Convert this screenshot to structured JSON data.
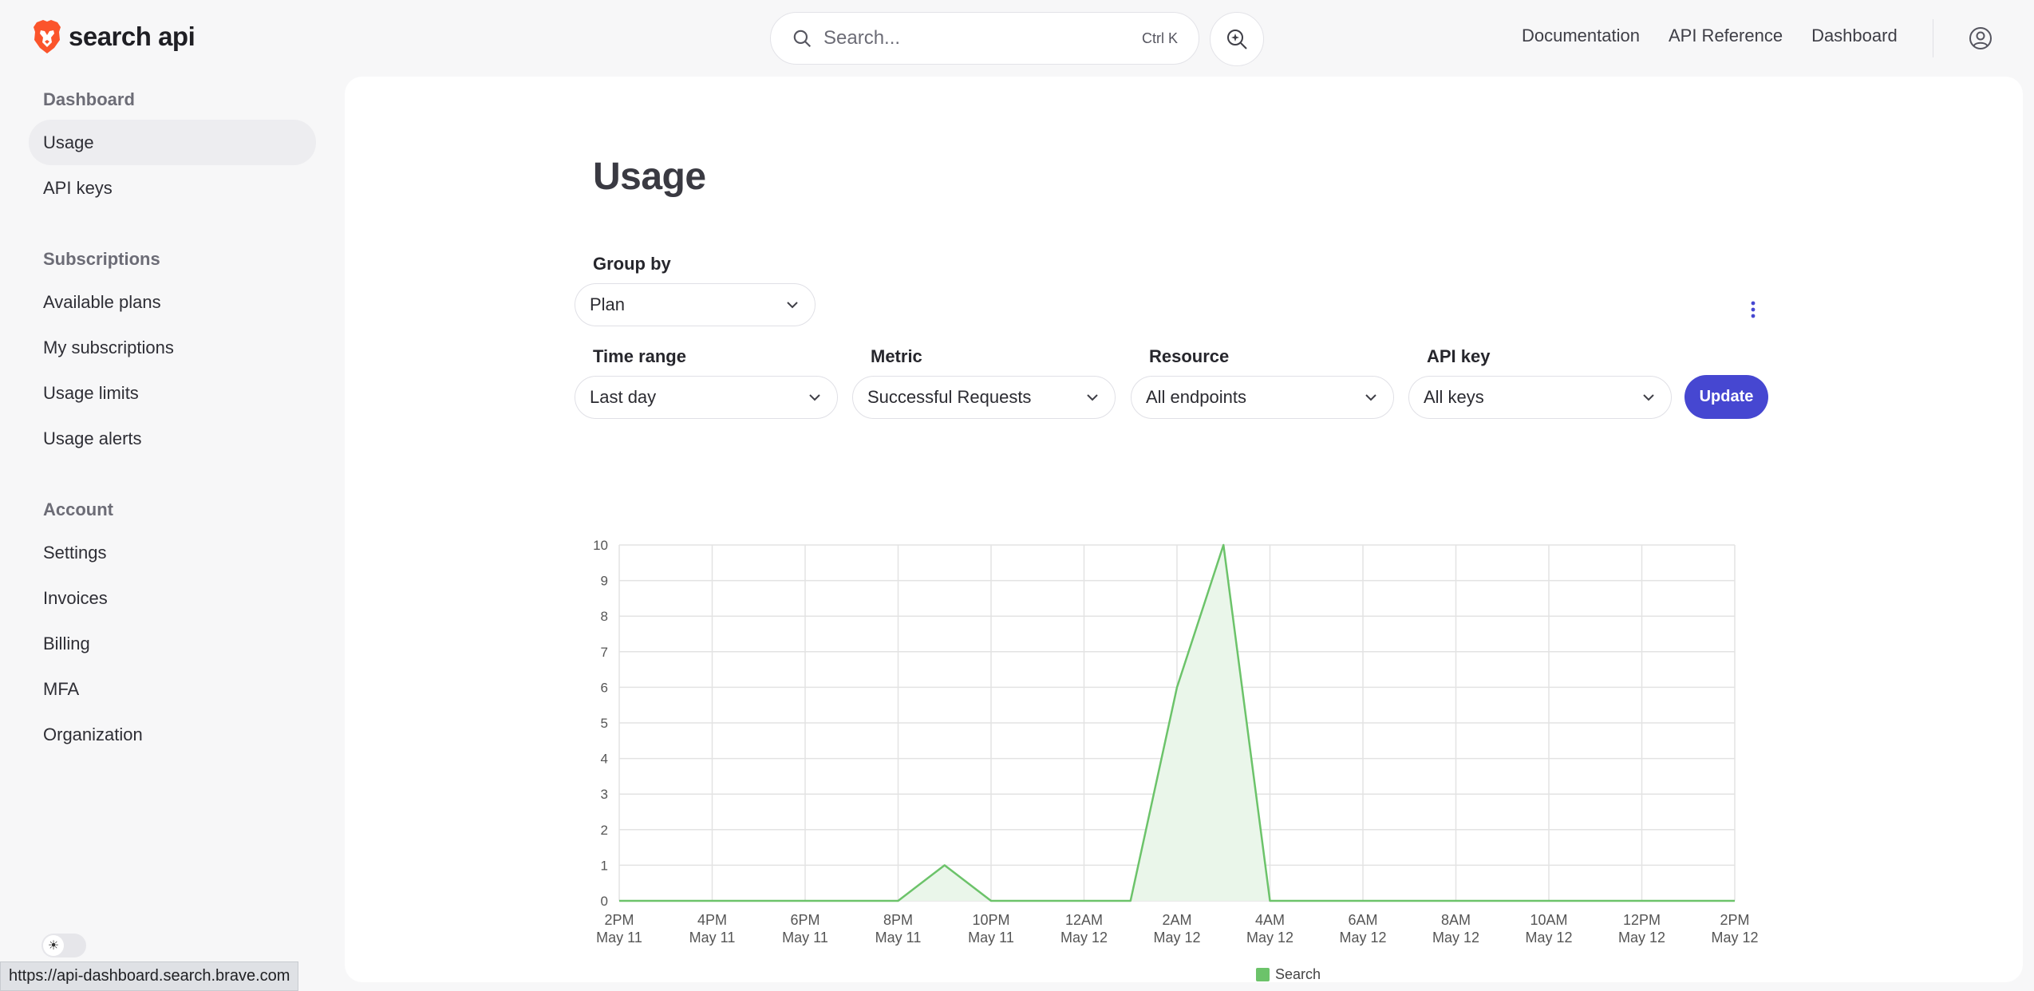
{
  "brand": {
    "name": "search api",
    "logo_icon": "lion-logo-icon"
  },
  "header": {
    "search": {
      "placeholder": "Search...",
      "shortcut": "Ctrl K"
    },
    "links": [
      {
        "label": "Documentation"
      },
      {
        "label": "API Reference"
      },
      {
        "label": "Dashboard"
      }
    ],
    "icons": {
      "search": "search-icon",
      "ai": "ai-search-icon",
      "account": "account-icon"
    }
  },
  "sidebar": {
    "sections": [
      {
        "heading": "Dashboard",
        "items": [
          "Usage",
          "API keys"
        ]
      },
      {
        "heading": "Subscriptions",
        "items": [
          "Available plans",
          "My subscriptions",
          "Usage limits",
          "Usage alerts"
        ]
      },
      {
        "heading": "Account",
        "items": [
          "Settings",
          "Invoices",
          "Billing",
          "MFA",
          "Organization"
        ]
      }
    ],
    "active_item": "Usage",
    "theme_toggle_glyph": "☀"
  },
  "status_bar": {
    "url": "https://api-dashboard.search.brave.com"
  },
  "main": {
    "title": "Usage",
    "group_by": {
      "label": "Group by",
      "value": "Plan"
    },
    "filters": {
      "time_range": {
        "label": "Time range",
        "value": "Last day"
      },
      "metric": {
        "label": "Metric",
        "value": "Successful Requests"
      },
      "resource": {
        "label": "Resource",
        "value": "All endpoints"
      },
      "api_key": {
        "label": "API key",
        "value": "All keys"
      }
    },
    "update_label": "Update"
  },
  "colors": {
    "accent": "#4647d1",
    "series": "#6cc36a",
    "series_fill": "#eaf6ea",
    "grid": "#e3e3e3"
  },
  "chart_data": {
    "type": "area",
    "x_ticks": [
      [
        "2PM",
        "May 11"
      ],
      [
        "4PM",
        "May 11"
      ],
      [
        "6PM",
        "May 11"
      ],
      [
        "8PM",
        "May 11"
      ],
      [
        "10PM",
        "May 11"
      ],
      [
        "12AM",
        "May 12"
      ],
      [
        "2AM",
        "May 12"
      ],
      [
        "4AM",
        "May 12"
      ],
      [
        "6AM",
        "May 12"
      ],
      [
        "8AM",
        "May 12"
      ],
      [
        "10AM",
        "May 12"
      ],
      [
        "12PM",
        "May 12"
      ],
      [
        "2PM",
        "May 12"
      ]
    ],
    "x_hours": [
      0,
      1,
      2,
      3,
      4,
      5,
      6,
      7,
      8,
      9,
      10,
      11,
      12,
      13,
      14,
      15,
      16,
      17,
      18,
      19,
      20,
      21,
      22,
      23,
      24
    ],
    "series": [
      {
        "name": "Search",
        "values": [
          0,
          0,
          0,
          0,
          0,
          0,
          0,
          1,
          0,
          0,
          0,
          0,
          6,
          10,
          0,
          0,
          0,
          0,
          0,
          0,
          0,
          0,
          0,
          0,
          0
        ]
      }
    ],
    "ylim": [
      0,
      10
    ],
    "y_ticks": [
      0,
      1,
      2,
      3,
      4,
      5,
      6,
      7,
      8,
      9,
      10
    ],
    "grid": true,
    "legend": "bottom-center"
  }
}
